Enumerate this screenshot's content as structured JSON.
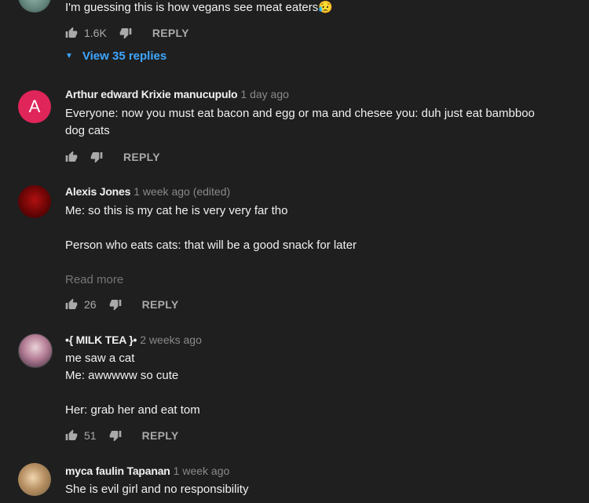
{
  "comments": [
    {
      "text_lines": [
        "I'm guessing this is how vegans see meat eaters😥"
      ],
      "likes": "1.6K",
      "reply_label": "REPLY",
      "view_replies": "View 35 replies"
    },
    {
      "avatar_letter": "A",
      "author": "Arthur edward Krixie manucupulo",
      "time": "1 day ago",
      "text_lines": [
        "Everyone: now you must eat bacon and egg or ma and chesee you: duh just eat bambboo",
        "dog cats"
      ],
      "likes": "",
      "reply_label": "REPLY"
    },
    {
      "author": "Alexis Jones",
      "time": "1 week ago (edited)",
      "text_lines": [
        "Me: so this is my cat he is very very far tho",
        "",
        "Person who eats cats: that will be a good snack for later"
      ],
      "read_more": "Read more",
      "likes": "26",
      "reply_label": "REPLY"
    },
    {
      "author": "•{ MILK TEA }•",
      "time": "2 weeks ago",
      "text_lines": [
        "me saw a cat",
        "Me: awwwww so cute",
        "",
        "Her: grab her and eat tom"
      ],
      "likes": "51",
      "reply_label": "REPLY"
    },
    {
      "author": "myca faulin Tapanan",
      "time": "1 week ago",
      "text_lines": [
        "She is evil girl and no responsibility"
      ]
    }
  ],
  "icons": {
    "like": "thumbs-up-icon",
    "dislike": "thumbs-down-icon",
    "expand": "caret-down-icon"
  },
  "colors": {
    "background": "#1f1f1f",
    "link": "#3ea6ff",
    "avatar_a": "#e0255a"
  }
}
